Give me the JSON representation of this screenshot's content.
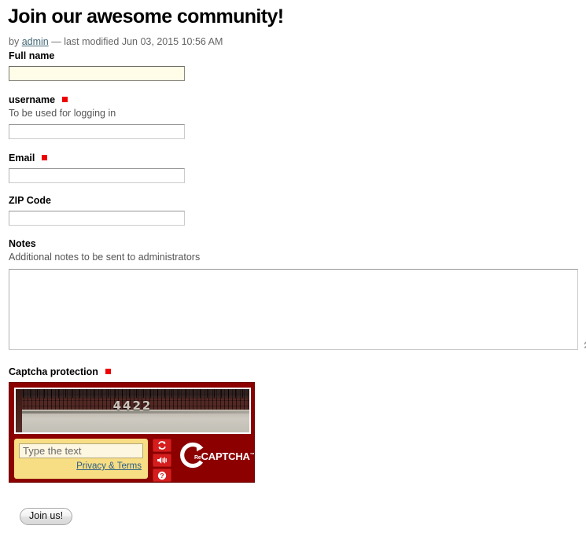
{
  "header": {
    "title": "Join our awesome community!",
    "byline_prefix": "by",
    "author": "admin",
    "byline_suffix": "— last modified Jun 03, 2015 10:56 AM"
  },
  "fields": {
    "full_name": {
      "label": "Full name",
      "value": "",
      "placeholder": ""
    },
    "username": {
      "label": "username",
      "help": "To be used for logging in",
      "value": "",
      "placeholder": "",
      "required": true
    },
    "email": {
      "label": "Email",
      "value": "",
      "placeholder": "",
      "required": true
    },
    "zip_code": {
      "label": "ZIP Code",
      "value": "",
      "placeholder": ""
    },
    "notes": {
      "label": "Notes",
      "help": "Additional notes to be sent to administrators",
      "value": "",
      "placeholder": ""
    },
    "captcha": {
      "label": "Captcha protection",
      "required": true
    }
  },
  "captcha": {
    "challenge_text": "4422",
    "input_placeholder": "Type the text",
    "input_value": "",
    "privacy_terms": "Privacy & Terms",
    "brand_re": "Re",
    "brand_captcha": "CAPTCHA",
    "brand_tm": "™",
    "buttons": {
      "refresh": "refresh-icon",
      "audio": "audio-icon",
      "help": "help-icon"
    },
    "colors": {
      "frame": "#8c0000",
      "entry_panel": "#f7dd84",
      "button": "#d61d1d"
    }
  },
  "submit": {
    "label": "Join us!"
  },
  "colors": {
    "required_marker": "#ee0000",
    "link": "#436976",
    "autofill_background": "#fffce8"
  }
}
